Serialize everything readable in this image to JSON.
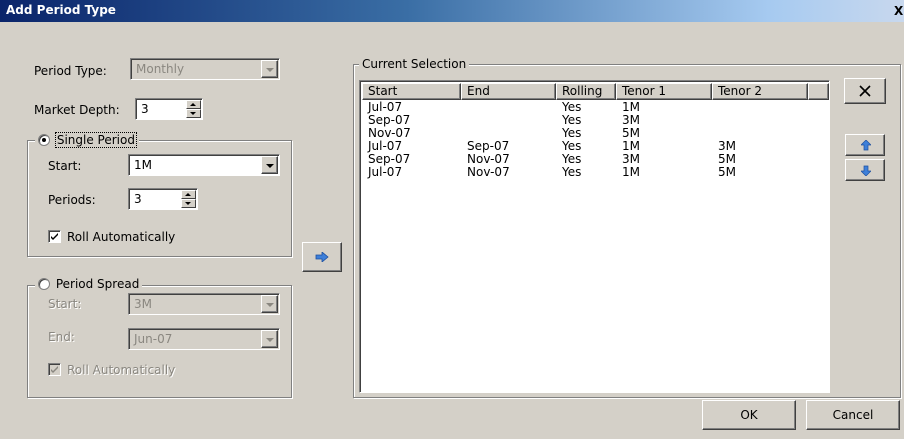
{
  "window": {
    "title": "Add Period Type",
    "close_glyph": "X"
  },
  "period_type": {
    "label": "Period Type:",
    "value": "Monthly"
  },
  "market_depth": {
    "label": "Market Depth:",
    "value": "3"
  },
  "single_period": {
    "label": "Single Period",
    "selected": true,
    "start_label": "Start:",
    "start_value": "1M",
    "periods_label": "Periods:",
    "periods_value": "3",
    "roll_label": "Roll Automatically",
    "roll_checked": true
  },
  "period_spread": {
    "label": "Period Spread",
    "selected": false,
    "start_label": "Start:",
    "start_value": "3M",
    "end_label": "End:",
    "end_value": "Jun-07",
    "roll_label": "Roll Automatically",
    "roll_checked": true
  },
  "add_button": {
    "icon": "arrow-right-icon"
  },
  "current_selection": {
    "label": "Current Selection",
    "columns": [
      "Start",
      "End",
      "Rolling",
      "Tenor 1",
      "Tenor 2"
    ],
    "rows": [
      [
        "Jul-07",
        "",
        "Yes",
        "1M",
        ""
      ],
      [
        "Sep-07",
        "",
        "Yes",
        "3M",
        ""
      ],
      [
        "Nov-07",
        "",
        "Yes",
        "5M",
        ""
      ],
      [
        "Jul-07",
        "Sep-07",
        "Yes",
        "1M",
        "3M"
      ],
      [
        "Sep-07",
        "Nov-07",
        "Yes",
        "3M",
        "5M"
      ],
      [
        "Jul-07",
        "Nov-07",
        "Yes",
        "1M",
        "5M"
      ]
    ]
  },
  "side_buttons": {
    "remove_icon": "close-x-icon",
    "up_icon": "arrow-up-icon",
    "down_icon": "arrow-down-icon"
  },
  "footer": {
    "ok_label": "OK",
    "cancel_label": "Cancel"
  },
  "colors": {
    "titlebar_start": "#0a246a",
    "titlebar_end": "#a6caf0",
    "face": "#d4d0c8",
    "arrow_blue": "#3d7fd9"
  }
}
